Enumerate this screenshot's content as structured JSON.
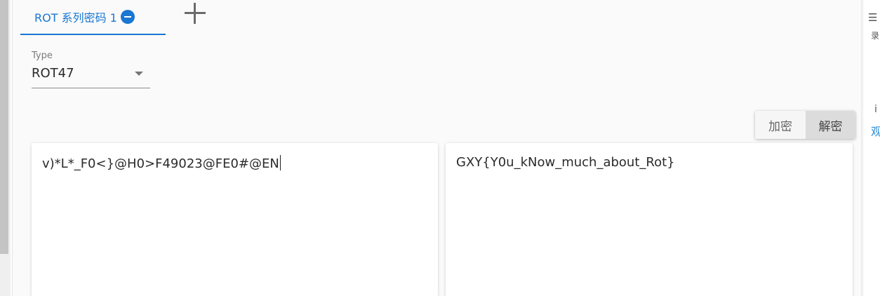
{
  "tab": {
    "label": "ROT 系列密码 1"
  },
  "type_select": {
    "caption": "Type",
    "value": "ROT47"
  },
  "actions": {
    "encrypt_label": "加密",
    "decrypt_label": "解密",
    "active": "decrypt"
  },
  "input_text": "v)*L*_F0<}@H0>F49023@FE0#@EN",
  "output_text": "GXY{Y0u_kNow_much_about_Rot}",
  "right_edge": {
    "icon_glyph": "☰",
    "text1": "录",
    "text2": "i",
    "text3": "观"
  },
  "colors": {
    "accent": "#1976d2",
    "active_button_bg": "#dcdcdc"
  }
}
